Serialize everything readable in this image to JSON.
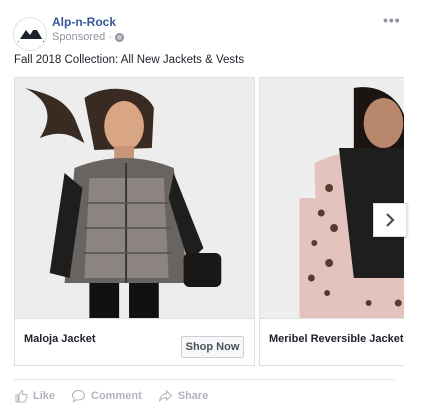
{
  "post": {
    "page_name": "Alp-n-Rock",
    "avatar_text": "ALP-N-ROCK",
    "sponsored": "Sponsored",
    "dot": "·",
    "more": "•••",
    "caption": "Fall 2018 Collection: All New Jackets & Vests"
  },
  "carousel": {
    "cards": [
      {
        "title": "Maloja Jacket",
        "cta": "Shop Now"
      },
      {
        "title": "Meribel Reversible Jacket"
      }
    ]
  },
  "actions": {
    "like": "Like",
    "comment": "Comment",
    "share": "Share"
  },
  "colors": {
    "link_blue": "#365899",
    "muted_gray": "#90949c",
    "border": "#dddfe2"
  }
}
